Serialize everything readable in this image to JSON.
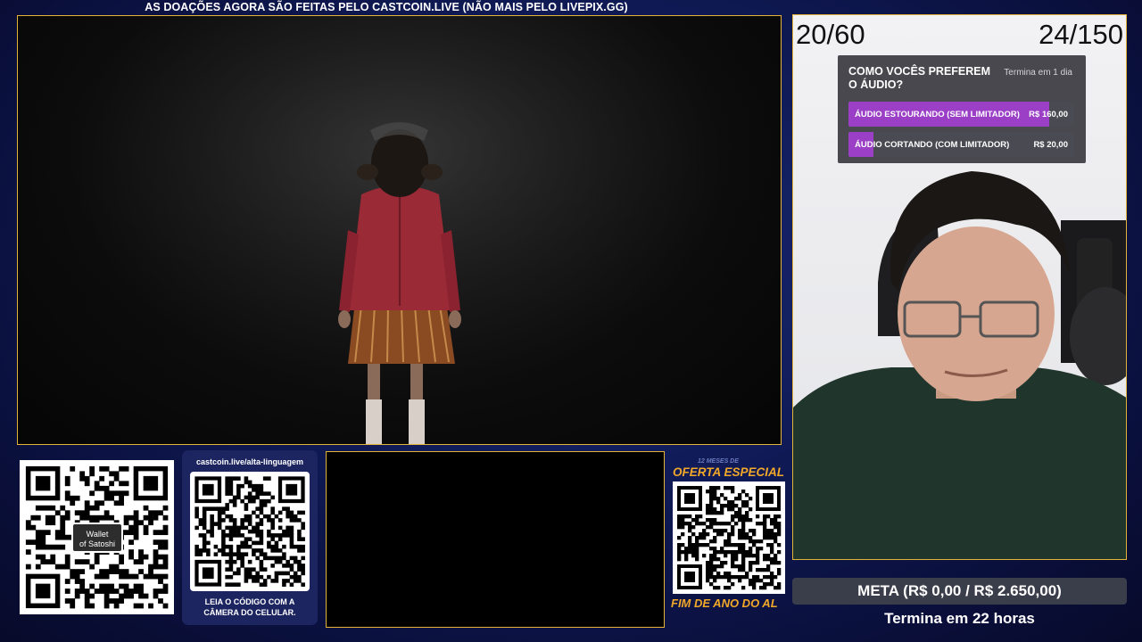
{
  "banner": {
    "text": "AS DOAÇÕES AGORA SÃO FEITAS PELO CASTCOIN.LIVE (NÃO MAIS PELO LIVEPIX.GG)"
  },
  "counters": {
    "left": "20/60",
    "right": "24/150"
  },
  "poll": {
    "title": "COMO VOCÊS PREFEREM O ÁUDIO?",
    "ends": "Termina em 1 dia",
    "options": [
      {
        "label": "ÁUDIO ESTOURANDO (SEM LIMITADOR)",
        "value": "R$ 160,00",
        "share": 0.89
      },
      {
        "label": "ÁUDIO CORTANDO (COM LIMITADOR)",
        "value": "R$ 20,00",
        "share": 0.11
      }
    ],
    "colors": {
      "fill": "#9b3fc7",
      "track": "#4a4a52"
    }
  },
  "qr_wallet": {
    "badge_line1": "Wallet",
    "badge_line2": "of Satoshi"
  },
  "castcoin_card": {
    "url": "castcoin.live/alta-linguagem",
    "caption_line1": "LEIA O CÓDIGO COM A",
    "caption_line2": "CÂMERA DO CELULAR."
  },
  "offer": {
    "small": "12 MESES DE",
    "top": "OFERTA ESPECIAL",
    "bottom": "FIM DE ANO DO AL"
  },
  "goal": {
    "text": "META (R$ 0,00 / R$ 2.650,00)",
    "ends": "Termina em 22 horas"
  },
  "colors": {
    "accent_border": "#e4b43a",
    "offer_orange": "#f2a829",
    "background": "#0f1a55"
  }
}
